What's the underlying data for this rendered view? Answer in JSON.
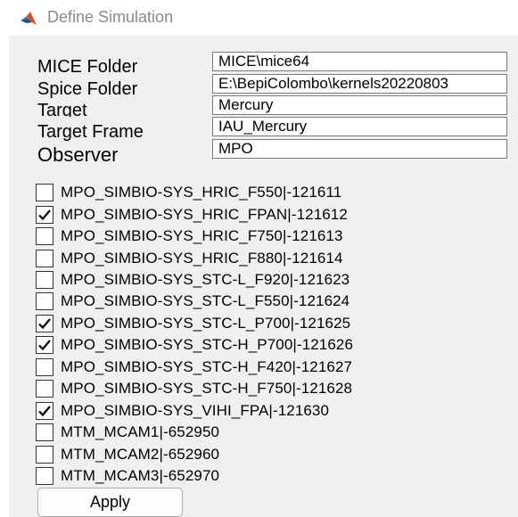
{
  "window": {
    "title": "Define Simulation"
  },
  "fields": [
    {
      "label": "MICE Folder",
      "value": "MICE\\mice64"
    },
    {
      "label": "Spice Folder",
      "value": "E:\\BepiColombo\\kernels20220803"
    },
    {
      "label": "Target",
      "value": "Mercury"
    },
    {
      "label": "Target Frame",
      "value": "IAU_Mercury"
    },
    {
      "label": "Observer",
      "value": "MPO"
    }
  ],
  "instruments": [
    {
      "label": "MPO_SIMBIO-SYS_HRIC_F550|-121611",
      "checked": false
    },
    {
      "label": "MPO_SIMBIO-SYS_HRIC_FPAN|-121612",
      "checked": true
    },
    {
      "label": "MPO_SIMBIO-SYS_HRIC_F750|-121613",
      "checked": false
    },
    {
      "label": "MPO_SIMBIO-SYS_HRIC_F880|-121614",
      "checked": false
    },
    {
      "label": "MPO_SIMBIO-SYS_STC-L_F920|-121623",
      "checked": false
    },
    {
      "label": "MPO_SIMBIO-SYS_STC-L_F550|-121624",
      "checked": false
    },
    {
      "label": "MPO_SIMBIO-SYS_STC-L_P700|-121625",
      "checked": true
    },
    {
      "label": "MPO_SIMBIO-SYS_STC-H_P700|-121626",
      "checked": true
    },
    {
      "label": "MPO_SIMBIO-SYS_STC-H_F420|-121627",
      "checked": false
    },
    {
      "label": "MPO_SIMBIO-SYS_STC-H_F750|-121628",
      "checked": false
    },
    {
      "label": "MPO_SIMBIO-SYS_VIHI_FPA|-121630",
      "checked": true
    },
    {
      "label": "MTM_MCAM1|-652950",
      "checked": false
    },
    {
      "label": "MTM_MCAM2|-652960",
      "checked": false
    },
    {
      "label": "MTM_MCAM3|-652970",
      "checked": false
    }
  ],
  "apply_button": {
    "label": "Apply"
  },
  "icons": {
    "app": "matlab-logo-icon",
    "check": "checkmark-icon"
  }
}
